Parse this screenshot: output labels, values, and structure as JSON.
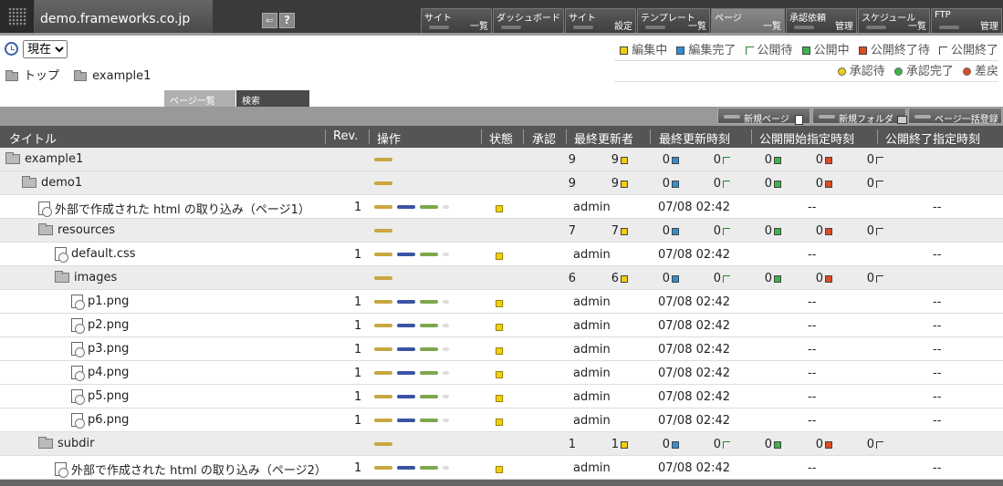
{
  "site": {
    "name": "demo.frameworks.co.jp"
  },
  "menu": [
    {
      "l1": "サイト",
      "l2": "一覧"
    },
    {
      "l1": "ダッシュボード",
      "l2": ""
    },
    {
      "l1": "サイト",
      "l2": "設定"
    },
    {
      "l1": "テンプレート",
      "l2": "一覧"
    },
    {
      "l1": "ページ",
      "l2": "一覧"
    },
    {
      "l1": "承認依頼",
      "l2": "管理"
    },
    {
      "l1": "スケジュール",
      "l2": "一覧"
    },
    {
      "l1": "FTP",
      "l2": "管理"
    }
  ],
  "period": {
    "selected": "現在"
  },
  "legend": {
    "editing": "編集中",
    "edit_done": "編集完了",
    "pub_wait": "公開待",
    "publishing": "公開中",
    "pub_end_wait": "公開終了待",
    "pub_end": "公開終了",
    "appr_wait": "承認待",
    "appr_done": "承認完了",
    "sendback": "差戻"
  },
  "breadcrumb": {
    "top": "トップ",
    "current": "example1"
  },
  "tabs": {
    "list": "ページ一覧",
    "search": "検索"
  },
  "toolbar": {
    "new_page": "新規ページ",
    "new_folder": "新規フォルダ",
    "bulk": "ページ一括登録"
  },
  "columns": {
    "title": "タイトル",
    "rev": "Rev.",
    "ops": "操作",
    "state": "状態",
    "approve": "承認",
    "updater": "最終更新者",
    "updated": "最終更新時刻",
    "pub_start": "公開開始指定時刻",
    "pub_end": "公開終了指定時刻"
  },
  "rows": [
    {
      "type": "folder",
      "indent": 0,
      "name": "example1",
      "c": [
        "9",
        "9",
        "0",
        "0",
        "0",
        "0",
        "0"
      ]
    },
    {
      "type": "folder",
      "indent": 1,
      "name": "demo1",
      "c": [
        "9",
        "9",
        "0",
        "0",
        "0",
        "0",
        "0"
      ]
    },
    {
      "type": "page",
      "indent": 2,
      "name": "外部で作成された html の取り込み（ページ1）",
      "rev": "1",
      "updater": "admin",
      "updated": "07/08 02:42",
      "pub_start": "--",
      "pub_end": "--"
    },
    {
      "type": "folder",
      "indent": 2,
      "name": "resources",
      "c": [
        "7",
        "7",
        "0",
        "0",
        "0",
        "0",
        "0"
      ]
    },
    {
      "type": "page",
      "indent": 3,
      "name": "default.css",
      "rev": "1",
      "updater": "admin",
      "updated": "07/08 02:42",
      "pub_start": "--",
      "pub_end": "--"
    },
    {
      "type": "folder",
      "indent": 3,
      "name": "images",
      "c": [
        "6",
        "6",
        "0",
        "0",
        "0",
        "0",
        "0"
      ]
    },
    {
      "type": "page",
      "indent": 4,
      "name": "p1.png",
      "rev": "1",
      "updater": "admin",
      "updated": "07/08 02:42",
      "pub_start": "--",
      "pub_end": "--"
    },
    {
      "type": "page",
      "indent": 4,
      "name": "p2.png",
      "rev": "1",
      "updater": "admin",
      "updated": "07/08 02:42",
      "pub_start": "--",
      "pub_end": "--"
    },
    {
      "type": "page",
      "indent": 4,
      "name": "p3.png",
      "rev": "1",
      "updater": "admin",
      "updated": "07/08 02:42",
      "pub_start": "--",
      "pub_end": "--"
    },
    {
      "type": "page",
      "indent": 4,
      "name": "p4.png",
      "rev": "1",
      "updater": "admin",
      "updated": "07/08 02:42",
      "pub_start": "--",
      "pub_end": "--"
    },
    {
      "type": "page",
      "indent": 4,
      "name": "p5.png",
      "rev": "1",
      "updater": "admin",
      "updated": "07/08 02:42",
      "pub_start": "--",
      "pub_end": "--"
    },
    {
      "type": "page",
      "indent": 4,
      "name": "p6.png",
      "rev": "1",
      "updater": "admin",
      "updated": "07/08 02:42",
      "pub_start": "--",
      "pub_end": "--"
    },
    {
      "type": "folder",
      "indent": 2,
      "name": "subdir",
      "c": [
        "1",
        "1",
        "0",
        "0",
        "0",
        "0",
        "0"
      ]
    },
    {
      "type": "page",
      "indent": 3,
      "name": "外部で作成された html の取り込み（ページ2）",
      "rev": "1",
      "updater": "admin",
      "updated": "07/08 02:42",
      "pub_start": "--",
      "pub_end": "--"
    }
  ],
  "colors": {
    "editing": "#f2cf00",
    "edit_done": "#2f8fd6",
    "publishing": "#39b54a",
    "pub_end_wait": "#e24a1e"
  }
}
